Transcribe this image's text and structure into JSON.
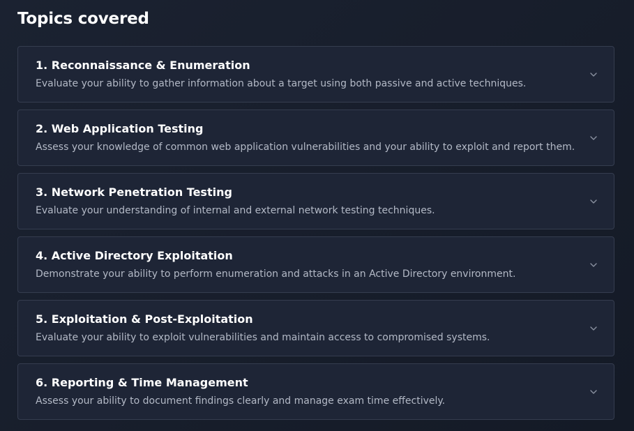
{
  "section": {
    "title": "Topics covered"
  },
  "topics": [
    {
      "title": "1. Reconnaissance & Enumeration",
      "description": "Evaluate your ability to gather information about a target using both passive and active techniques."
    },
    {
      "title": "2. Web Application Testing",
      "description": "Assess your knowledge of common web application vulnerabilities and your ability to exploit and report them."
    },
    {
      "title": "3. Network Penetration Testing",
      "description": "Evaluate your understanding of internal and external network testing techniques."
    },
    {
      "title": "4. Active Directory Exploitation",
      "description": "Demonstrate your ability to perform enumeration and attacks in an Active Directory environment."
    },
    {
      "title": "5. Exploitation & Post-Exploitation",
      "description": "Evaluate your ability to exploit vulnerabilities and maintain access to compromised systems."
    },
    {
      "title": "6. Reporting & Time Management",
      "description": "Assess your ability to document findings clearly and manage exam time effectively."
    }
  ],
  "icons": {
    "expand": "chevron-down-icon"
  },
  "colors": {
    "background": "#171d2a",
    "card": "#1e2536",
    "border": "#353d4f",
    "title": "#ffffff",
    "description": "#b3b9c6",
    "chevron": "#8a91a0"
  }
}
